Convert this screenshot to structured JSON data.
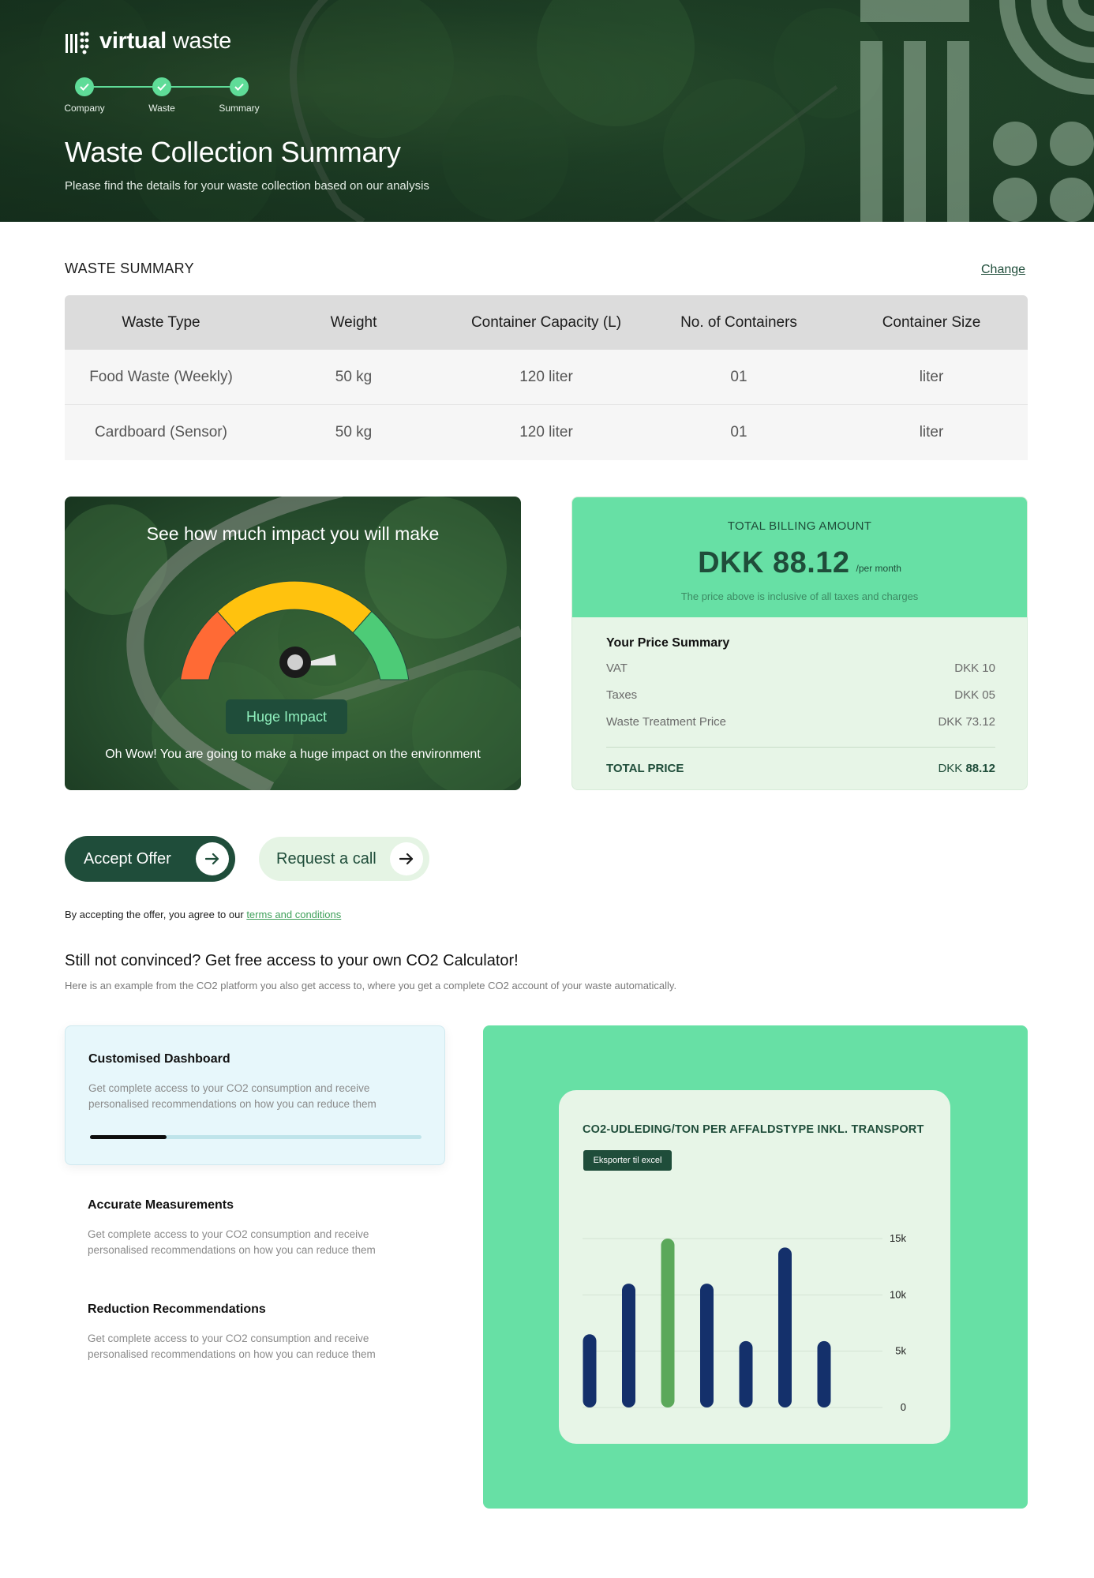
{
  "brand": {
    "name_bold": "virtual",
    "name_light": " waste"
  },
  "stepper": {
    "steps": [
      "Company",
      "Waste",
      "Summary"
    ]
  },
  "hero": {
    "title": "Waste Collection Summary",
    "subtitle": "Please find the details for your waste collection based on our analysis"
  },
  "waste_summary": {
    "title": "WASTE SUMMARY",
    "change_label": "Change",
    "columns": [
      "Waste Type",
      "Weight",
      "Container Capacity (L)",
      "No. of Containers",
      "Container Size"
    ],
    "rows": [
      [
        "Food Waste (Weekly)",
        "50 kg",
        "120 liter",
        "01",
        "liter"
      ],
      [
        "Cardboard (Sensor)",
        "50 kg",
        "120 liter",
        "01",
        "liter"
      ]
    ]
  },
  "impact": {
    "title": "See how much impact you will make",
    "badge": "Huge Impact",
    "note": "Oh Wow! You are going to make a huge impact on the environment",
    "level": 0.85
  },
  "billing": {
    "label": "TOTAL BILLING AMOUNT",
    "amount": "DKK 88.12",
    "per": "/per month",
    "note": "The price above is inclusive of all taxes and charges",
    "summary_title": "Your Price Summary",
    "lines": [
      {
        "label": "VAT",
        "value": "DKK 10"
      },
      {
        "label": "Taxes",
        "value": "DKK 05"
      },
      {
        "label": "Waste Treatment Price",
        "value": "DKK 73.12"
      }
    ],
    "total_label": "TOTAL PRICE",
    "total_currency": "DKK ",
    "total_value": "88.12"
  },
  "cta": {
    "accept": "Accept Offer",
    "call": "Request a call",
    "terms_prefix": "By accepting the offer, you agree to our ",
    "terms_link": "terms and conditions"
  },
  "co2": {
    "title": "Still not convinced? Get free access to your own CO2 Calculator!",
    "subtitle": "Here is an example from the CO2 platform you also get access to, where you get a complete CO2 account of your waste automatically.",
    "features": [
      {
        "title": "Customised Dashboard",
        "desc": "Get complete access to your CO2 consumption and receive personalised recommendations on how you can reduce them",
        "progress": 0.23
      },
      {
        "title": "Accurate Measurements",
        "desc": "Get complete access to your CO2 consumption and receive personalised recommendations on how you can reduce them"
      },
      {
        "title": "Reduction Recommendations",
        "desc": "Get complete access to your CO2 consumption and receive personalised recommendations on how you can reduce them"
      }
    ],
    "chart_card": {
      "title": "CO2-UDLEDING/TON PER AFFALDSTYPE INKL. TRANSPORT",
      "export_label": "Eksporter til excel"
    }
  },
  "colors": {
    "brand_dark": "#1f4d3a",
    "mint": "#67e0a5",
    "light_green": "#e7f5e7",
    "bar_navy": "#14306b",
    "bar_green": "#5ba85a"
  },
  "chart_data": {
    "type": "bar",
    "title": "CO2-UDLEDING/TON PER AFFALDSTYPE INKL. TRANSPORT",
    "xlabel": "",
    "ylabel": "",
    "ylim": [
      0,
      15000
    ],
    "yticks": [
      "0",
      "5k",
      "10k",
      "15k"
    ],
    "ytick_values": [
      0,
      5000,
      10000,
      15000
    ],
    "values": [
      6500,
      11000,
      15000,
      11000,
      5900,
      14200,
      5900
    ],
    "highlight_index": 2,
    "grid": true,
    "legend": "none"
  }
}
